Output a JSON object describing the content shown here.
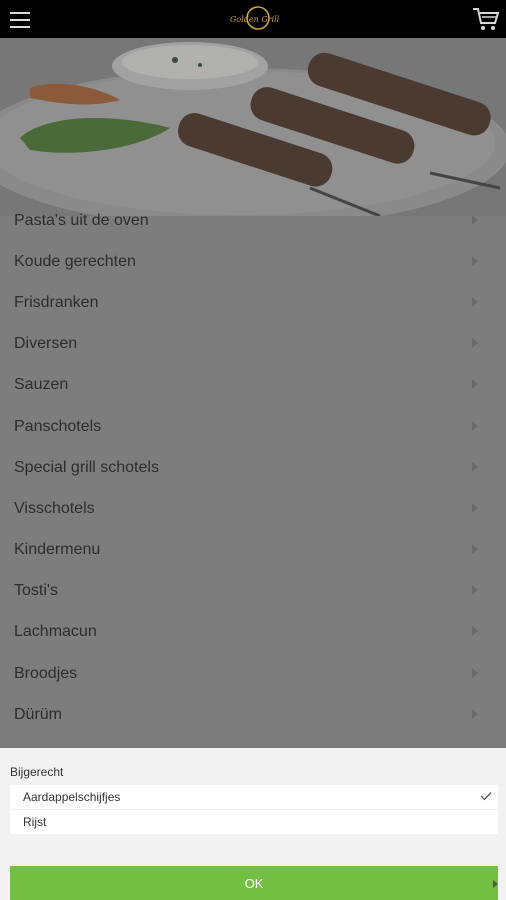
{
  "header": {
    "menu_icon": "hamburger-icon",
    "logo_text": "Golden Grill",
    "cart_icon": "shopping-cart-icon"
  },
  "hero": {
    "image": "kebab-skewers-plate"
  },
  "menu": {
    "items": [
      {
        "label": "Pasta's uit de oven"
      },
      {
        "label": "Koude gerechten"
      },
      {
        "label": "Frisdranken"
      },
      {
        "label": "Diversen"
      },
      {
        "label": "Sauzen"
      },
      {
        "label": "Panschotels"
      },
      {
        "label": "Special grill schotels"
      },
      {
        "label": "Visschotels"
      },
      {
        "label": "Kindermenu"
      },
      {
        "label": "Tosti's"
      },
      {
        "label": "Lachmacun"
      },
      {
        "label": "Broodjes"
      },
      {
        "label": "Dürüm"
      }
    ]
  },
  "sheet": {
    "title": "Bijgerecht",
    "options": [
      {
        "label": "Aardappelschijfjes",
        "selected": true
      },
      {
        "label": "Rijst",
        "selected": false
      }
    ],
    "ok_label": "OK",
    "accent": "#72bf44"
  }
}
